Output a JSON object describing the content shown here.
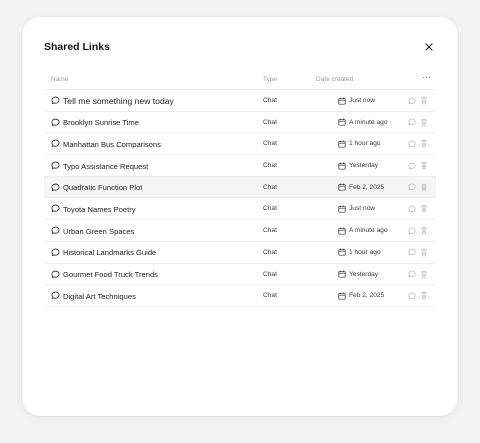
{
  "dialog": {
    "title": "Shared Links",
    "close_icon": "close-icon"
  },
  "table": {
    "headers": {
      "name": "Name",
      "type": "Type",
      "date": "Date created",
      "more": "···"
    },
    "rows": [
      {
        "name": "Tell me something new today",
        "type": "Chat",
        "date": "Just now",
        "highlighted": false
      },
      {
        "name": "Brooklyn Sunrise Time",
        "type": "Chat",
        "date": "A minute ago",
        "highlighted": false
      },
      {
        "name": "Manhattan Bus Comparisons",
        "type": "Chat",
        "date": "1 hour ago",
        "highlighted": false
      },
      {
        "name": "Typo Assistance Request",
        "type": "Chat",
        "date": "Yesterday",
        "highlighted": false
      },
      {
        "name": "Quadratic Function Plot",
        "type": "Chat",
        "date": "Feb 2, 2025",
        "highlighted": true
      },
      {
        "name": "Toyota Names Poetry",
        "type": "Chat",
        "date": "Just now",
        "highlighted": false
      },
      {
        "name": "Urban Green Spaces",
        "type": "Chat",
        "date": "A minute ago",
        "highlighted": false
      },
      {
        "name": "Historical Landmarks Guide",
        "type": "Chat",
        "date": "1 hour ago",
        "highlighted": false
      },
      {
        "name": "Gourmet Food Truck Trends",
        "type": "Chat",
        "date": "Yesterday",
        "highlighted": false
      },
      {
        "name": "Digital Art Techniques",
        "type": "Chat",
        "date": "Feb 2, 2025",
        "highlighted": false
      }
    ]
  },
  "icons": {
    "row_type": "chat-bubble-icon",
    "date": "calendar-icon",
    "open_chat": "chat-bubble-icon",
    "delete": "trash-icon"
  },
  "colors": {
    "background": "#f3f3f4",
    "panel": "#ffffff",
    "highlight_row": "#f5f5f6",
    "muted_text": "#9c9c9f"
  }
}
